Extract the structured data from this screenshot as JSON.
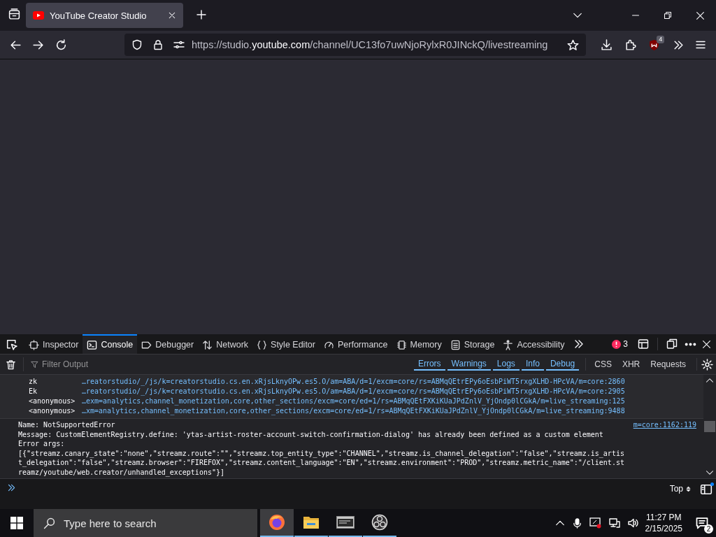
{
  "browser": {
    "tabs": [
      {
        "title": "YouTube Creator Studio",
        "selected": true
      }
    ],
    "url": {
      "scheme": "https://studio.",
      "domain": "youtube.com",
      "path": "/channel/UC13fo7uwNjoRylxR0JINckQ/livestreaming"
    },
    "extension_badge": "4"
  },
  "devtools": {
    "tabs": [
      {
        "label": "Inspector",
        "selected": false
      },
      {
        "label": "Console",
        "selected": true
      },
      {
        "label": "Debugger",
        "selected": false
      },
      {
        "label": "Network",
        "selected": false
      },
      {
        "label": "Style Editor",
        "selected": false
      },
      {
        "label": "Performance",
        "selected": false
      },
      {
        "label": "Memory",
        "selected": false
      },
      {
        "label": "Storage",
        "selected": false
      },
      {
        "label": "Accessibility",
        "selected": false
      }
    ],
    "error_count": "3",
    "filter": {
      "placeholder": "Filter Output"
    },
    "levels": [
      {
        "label": "Errors",
        "selected": true
      },
      {
        "label": "Warnings",
        "selected": true
      },
      {
        "label": "Logs",
        "selected": true
      },
      {
        "label": "Info",
        "selected": true
      },
      {
        "label": "Debug",
        "selected": true
      }
    ],
    "types": [
      {
        "label": "CSS",
        "selected": false
      },
      {
        "label": "XHR",
        "selected": false
      },
      {
        "label": "Requests",
        "selected": false
      }
    ],
    "stack": [
      {
        "function": "zk",
        "location": "…reatorstudio/_/js/k=creatorstudio.cs.en.xRjsLknyOPw.es5.O/am=ABA/d=1/excm=core/rs=ABMqQEtrEPy6oEsbPiWT5rxgXLHD-HPcVA/m=core:2860"
      },
      {
        "function": "Ek",
        "location": "…reatorstudio/_/js/k=creatorstudio.cs.en.xRjsLknyOPw.es5.O/am=ABA/d=1/excm=core/rs=ABMqQEtrEPy6oEsbPiWT5rxgXLHD-HPcVA/m=core:2905"
      },
      {
        "function": "<anonymous>",
        "location": "…exm=analytics,channel_monetization,core,other_sections/excm=core/ed=1/rs=ABMqQEtFXKiKUaJPdZnlV_YjOndp0lCGkA/m=live_streaming:125"
      },
      {
        "function": "<anonymous>",
        "location": "…xm=analytics,channel_monetization,core,other_sections/excm=core/ed=1/rs=ABMqQEtFXKiKUaJPdZnlV_YjOndp0lCGkA/m=live_streaming:9488"
      }
    ],
    "message": {
      "source": "m=core:1162:119",
      "lines": [
        "Name: NotSupportedError",
        "Message: CustomElementRegistry.define: 'ytas-artist-roster-account-switch-confirmation-dialog' has already been defined as a custom element",
        "Error args:",
        "[{\"streamz.canary_state\":\"none\",\"streamz.route\":\"\",\"streamz.top_entity_type\":\"CHANNEL\",\"streamz.is_channel_delegation\":\"false\",\"streamz.is_artist_delegation\":\"false\",\"streamz.browser\":\"FIREFOX\",\"streamz.content_language\":\"EN\",\"streamz.environment\":\"PROD\",\"streamz.metric_name\":\"/client.streamz/youtube/web.creator/unhandled_exceptions\"}]"
      ]
    },
    "context": "Top"
  },
  "taskbar": {
    "search": {
      "placeholder": "Type here to search"
    },
    "apps": [
      {
        "selected": true
      },
      {
        "selected": false
      },
      {
        "selected": false
      },
      {
        "selected": false
      }
    ],
    "time": "11:27 PM",
    "date": "2/15/2025",
    "notification_count": "2"
  }
}
